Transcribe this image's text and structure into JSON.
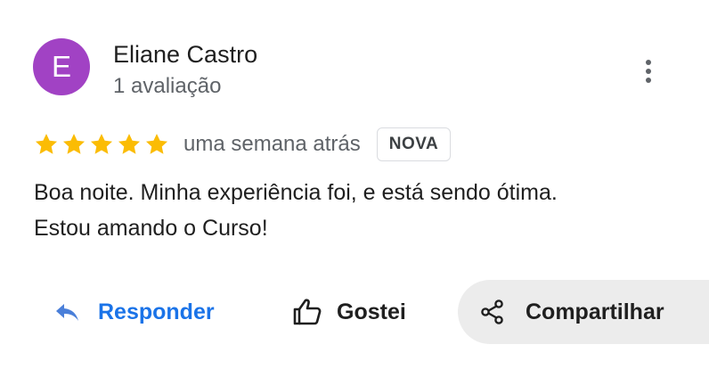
{
  "review": {
    "avatar_letter": "E",
    "avatar_color": "#a142c4",
    "author_name": "Eliane Castro",
    "review_count": "1 avaliação",
    "rating": 5,
    "rating_max": 5,
    "star_color": "#fbbc04",
    "time_ago": "uma semana atrás",
    "badge": "NOVA",
    "text_lines": [
      "Boa noite. Minha experiência foi, e está sendo ótima.",
      "Estou amando o Curso!"
    ]
  },
  "actions": {
    "reply_label": "Responder",
    "reply_icon": "reply-icon",
    "like_label": "Gostei",
    "like_icon": "thumb-up-icon",
    "share_label": "Compartilhar",
    "share_icon": "share-icon",
    "more_icon": "more-vert-icon"
  },
  "colors": {
    "link_blue": "#1a73e8",
    "share_bg": "#ececec"
  }
}
